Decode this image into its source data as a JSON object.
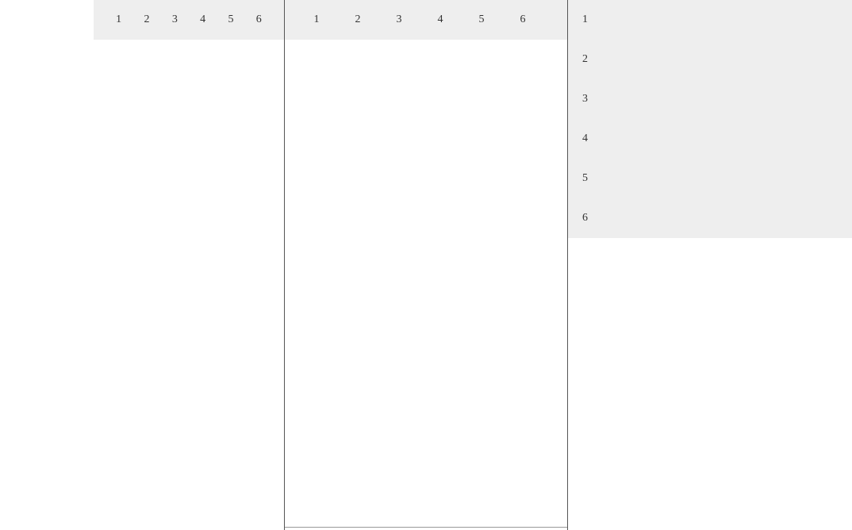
{
  "panels": {
    "left": {
      "items": [
        "1",
        "2",
        "3",
        "4",
        "5",
        "6"
      ]
    },
    "middle": {
      "items": [
        "1",
        "2",
        "3",
        "4",
        "5",
        "6"
      ]
    },
    "right": {
      "items": [
        "1",
        "2",
        "3",
        "4",
        "5",
        "6"
      ]
    }
  }
}
